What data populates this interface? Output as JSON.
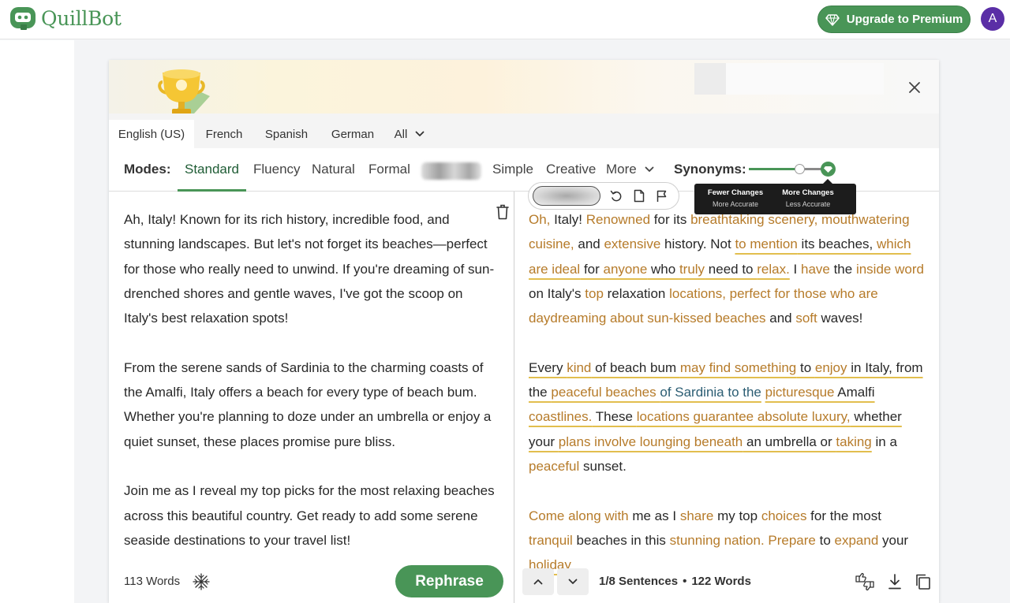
{
  "app": {
    "name": "QuillBot",
    "brand_color": "#499557"
  },
  "header": {
    "upgrade_label": "Upgrade to Premium",
    "avatar_letter": "A"
  },
  "languages": {
    "tabs": [
      "English (US)",
      "French",
      "Spanish",
      "German",
      "All"
    ],
    "active": "English (US)"
  },
  "modes": {
    "title": "Modes:",
    "items": [
      "Standard",
      "Fluency",
      "Natural",
      "Formal",
      "Simple",
      "Creative"
    ],
    "more_label": "More",
    "active": "Standard"
  },
  "synonyms": {
    "label": "Synonyms:",
    "level": 0.66,
    "tooltip": {
      "left_title": "Fewer Changes",
      "left_sub": "More Accurate",
      "right_title": "More Changes",
      "right_sub": "Less Accurate"
    }
  },
  "input": {
    "paragraphs": [
      "Ah, Italy! Known for its rich history, incredible food, and stunning landscapes. But let's not forget its beaches—perfect for those who really need to unwind. If you're dreaming of sun-drenched shores and gentle waves, I've got the scoop on Italy's best relaxation spots!",
      "From the serene sands of Sardinia to the charming coasts of the Amalfi, Italy offers a beach for every type of beach bum. Whether you're planning to doze under an umbrella or enjoy a quiet sunset, these places promise pure bliss.",
      "Join me as I reveal my top picks for the most relaxing beaches across this beautiful country. Get ready to add some serene seaside destinations to your travel list!"
    ],
    "word_count": "113 Words",
    "rephrase_label": "Rephrase"
  },
  "output": {
    "paragraphs": [
      [
        [
          "Oh,",
          "c"
        ],
        [
          " Italy! ",
          ""
        ],
        [
          "Renowned",
          "c"
        ],
        [
          " for its ",
          ""
        ],
        [
          "breathtaking scenery, mouthwatering cuisine,",
          "c"
        ],
        [
          " and ",
          ""
        ],
        [
          "extensive",
          "c"
        ],
        [
          " history. Not ",
          ""
        ],
        [
          "to mention",
          "cu"
        ],
        [
          " its beaches, ",
          "u"
        ],
        [
          "which are ideal",
          "cu"
        ],
        [
          " for ",
          "u"
        ],
        [
          "anyone",
          "cu"
        ],
        [
          " who ",
          "u"
        ],
        [
          "truly",
          "cu"
        ],
        [
          " need to ",
          "u"
        ],
        [
          "relax.",
          "cu"
        ],
        [
          " I ",
          ""
        ],
        [
          "have",
          "c"
        ],
        [
          " the ",
          ""
        ],
        [
          "inside word",
          "c"
        ],
        [
          " on Italy's ",
          ""
        ],
        [
          "top",
          "c"
        ],
        [
          " relaxation ",
          ""
        ],
        [
          "locations, perfect for those who are daydreaming about sun-kissed beaches",
          "c"
        ],
        [
          " and ",
          ""
        ],
        [
          "soft",
          "c"
        ],
        [
          " waves!",
          ""
        ]
      ],
      [
        [
          "Every ",
          "u"
        ],
        [
          "kind",
          "cu"
        ],
        [
          " of beach bum ",
          "u"
        ],
        [
          "may find something",
          "cu"
        ],
        [
          " to ",
          "u"
        ],
        [
          "enjoy",
          "cu"
        ],
        [
          " in Italy, from the ",
          "u"
        ],
        [
          "peaceful beaches ",
          "cu"
        ],
        [
          "of Sardinia to the",
          "su"
        ],
        [
          " ",
          "u"
        ],
        [
          "picturesque",
          "cu"
        ],
        [
          " Amalfi ",
          "u"
        ],
        [
          "coastlines.",
          "cu"
        ],
        [
          " These ",
          "u"
        ],
        [
          "locations guarantee absolute luxury,",
          "cu"
        ],
        [
          " whether your ",
          "u"
        ],
        [
          "plans involve lounging beneath",
          "cu"
        ],
        [
          " an umbrella or ",
          "u"
        ],
        [
          "taking",
          "cu"
        ],
        [
          " in a ",
          ""
        ],
        [
          "peaceful",
          "c"
        ],
        [
          " sunset.",
          ""
        ]
      ],
      [
        [
          "Come along with",
          "c"
        ],
        [
          " me as I ",
          ""
        ],
        [
          "share",
          "c"
        ],
        [
          " my top ",
          ""
        ],
        [
          "choices",
          "c"
        ],
        [
          " for the most ",
          ""
        ],
        [
          "tranquil",
          "c"
        ],
        [
          " beaches in this ",
          ""
        ],
        [
          "stunning nation. Prepare",
          "c"
        ],
        [
          " to ",
          ""
        ],
        [
          "expand",
          "c"
        ],
        [
          " your ",
          ""
        ],
        [
          "holiday",
          "cu"
        ]
      ]
    ],
    "sentence_position": "1/8 Sentences",
    "separator": "•",
    "word_count": "122 Words"
  }
}
